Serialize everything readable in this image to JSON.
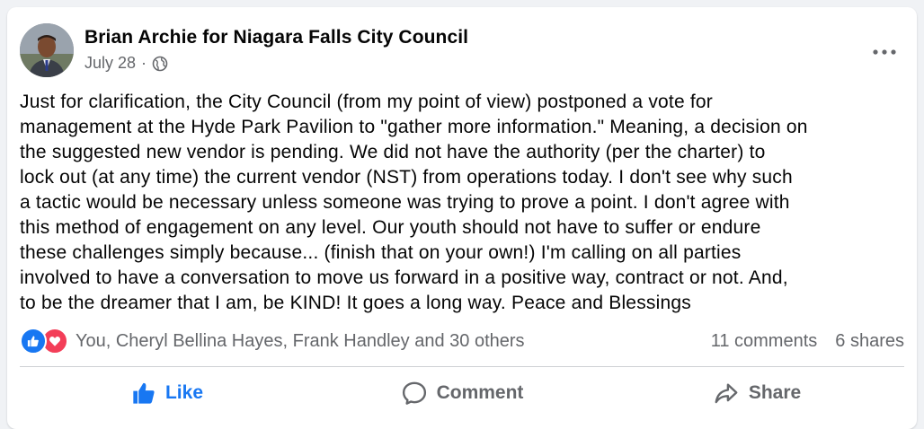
{
  "post": {
    "author": "Brian Archie for Niagara Falls City Council",
    "date": "July 28",
    "separator": "·",
    "audience_icon": "globe-icon",
    "more_icon": "ellipsis-icon",
    "text": "Just for clarification, the City Council (from my point of view) postponed a vote for\nmanagement at the Hyde Park Pavilion to \"gather more information.\" Meaning, a decision on\nthe suggested new vendor is pending.  We did not have the authority (per the charter) to\nlock out (at any time) the current vendor (NST) from operations today.  I don't see why such\na tactic would be necessary unless someone was trying to prove a point.  I don't agree with\nthis method of engagement on any level.  Our youth should not have to suffer or endure\nthese challenges simply because... (finish that on your own!)   I'm calling on all parties\ninvolved to have a conversation to move us forward in a positive way, contract or not.  And,\nto be the dreamer that I am, be KIND!  It goes a long way.  Peace and Blessings"
  },
  "stats": {
    "reaction_icons": [
      "like-icon",
      "love-icon"
    ],
    "reactions_text": "You, Cheryl Bellina Hayes, Frank Handley and 30 others",
    "comments": "11 comments",
    "shares": "6 shares"
  },
  "actions": {
    "like": "Like",
    "comment": "Comment",
    "share": "Share"
  },
  "colors": {
    "accent": "#1877f2",
    "love": "#f33e58",
    "secondary_text": "#65676b",
    "background": "#f0f2f5"
  }
}
